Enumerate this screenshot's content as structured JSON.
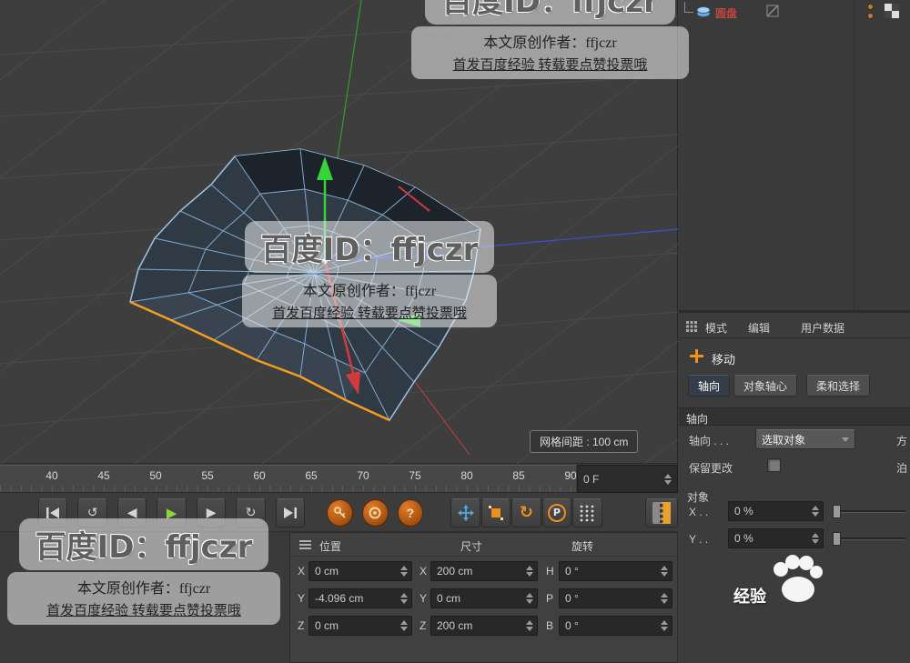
{
  "viewport": {
    "grid_label": "网格间距 : 100 cm"
  },
  "watermark": {
    "big": "百度ID：ffjczr",
    "line1": "本文原创作者：ffjczr",
    "line2": "首发百度经验 转载要点赞投票哦",
    "logo_text": "经验"
  },
  "object_manager": {
    "item": "圆盘"
  },
  "attributes": {
    "menu": [
      "模式",
      "编辑",
      "用户数据"
    ],
    "tool_label": "移动",
    "tabs": [
      "轴向",
      "对象轴心",
      "柔和选择"
    ],
    "axis_section": "轴向",
    "axis_label": "轴向 . . .",
    "axis_dropdown": "选取对象",
    "axis_cut": "方",
    "keep_label": "保留更改",
    "keep_cut": "泊",
    "object_section": "对象",
    "x_label": "X . .",
    "x_value": "0 %",
    "y_label": "Y . .",
    "y_value": "0 %"
  },
  "timeline": {
    "ticks": [
      "40",
      "45",
      "50",
      "55",
      "60",
      "65",
      "70",
      "75",
      "80",
      "85",
      "90"
    ],
    "frame": "0 F"
  },
  "transport": {
    "loop_back": "↺",
    "prev": "◀",
    "play": "▶",
    "next": "▶",
    "loop": "↻",
    "question": "?",
    "p_label": "P",
    "rotate": "↻"
  },
  "coords": {
    "headers": [
      "位置",
      "尺寸",
      "旋转"
    ],
    "rows": [
      {
        "l1": "X",
        "v1": "0 cm",
        "l2": "X",
        "v2": "200 cm",
        "l3": "H",
        "v3": "0 °"
      },
      {
        "l1": "Y",
        "v1": "-4.096 cm",
        "l2": "Y",
        "v2": "0 cm",
        "l3": "P",
        "v3": "0 °"
      },
      {
        "l1": "Z",
        "v1": "0 cm",
        "l2": "Z",
        "v2": "200 cm",
        "l3": "B",
        "v3": "0 °"
      }
    ]
  },
  "colors": {
    "accent_orange": "#ef8f1c",
    "axis_green": "#3ecb3e",
    "axis_red": "#d64040",
    "axis_blue": "#3b4fd8",
    "wireframe": "#86b3da",
    "selected_edge": "#f59d1f",
    "play_green": "#8ad43c"
  }
}
